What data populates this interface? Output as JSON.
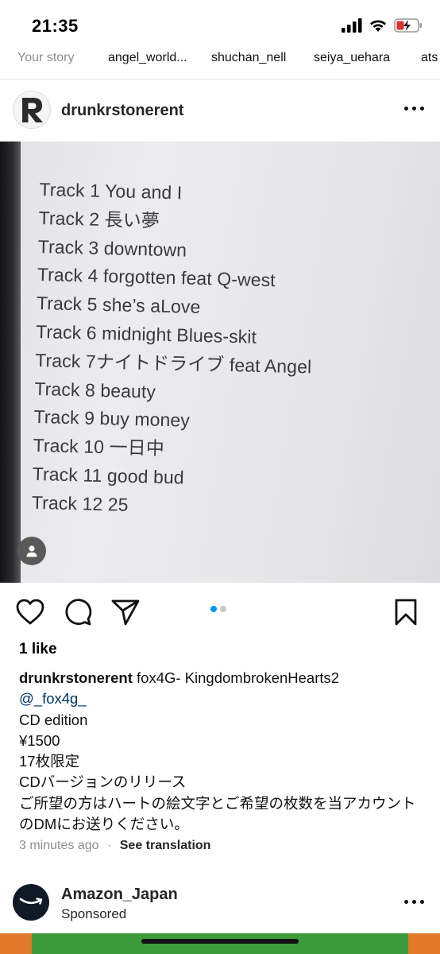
{
  "status_bar": {
    "time": "21:35"
  },
  "stories": [
    {
      "name": "Your story",
      "own": true
    },
    {
      "name": "angel_world..."
    },
    {
      "name": "shuchan_nell"
    },
    {
      "name": "seiya_uehara"
    },
    {
      "name": "ats"
    }
  ],
  "post": {
    "username": "drunkrstonerent",
    "avatar_letter": "R",
    "photo_tracks": [
      "Track 1 You and I",
      "Track 2 長い夢",
      "Track 3 downtown",
      "Track 4 forgotten feat Q-west",
      "Track 5 she’s aLove",
      "Track 6 midnight Blues-skit",
      "Track 7ナイトドライブ feat Angel",
      "Track 8 beauty",
      "Track 9 buy money",
      "Track 10 一日中",
      "Track 11 good bud",
      "Track 12 25"
    ],
    "likes": "1 like",
    "caption": {
      "user": "drunkrstonerent",
      "text_first": " fox4G- KingdombrokenHearts2",
      "mention": "@_fox4g_",
      "lines": [
        "CD edition",
        "¥1500",
        "17枚限定",
        "CDバージョンのリリース",
        "ご所望の方はハートの絵文字とご希望の枚数を当アカウントのDMにお送りください。"
      ]
    },
    "time_ago": "3 minutes ago",
    "separator": "·",
    "see_translation": "See translation"
  },
  "next_post": {
    "username": "Amazon_Japan",
    "sponsored": "Sponsored"
  },
  "colors": {
    "accent": "#0095f6",
    "mention": "#00376b",
    "muted": "#8e8e8e",
    "battery_red": "#e0312b"
  }
}
